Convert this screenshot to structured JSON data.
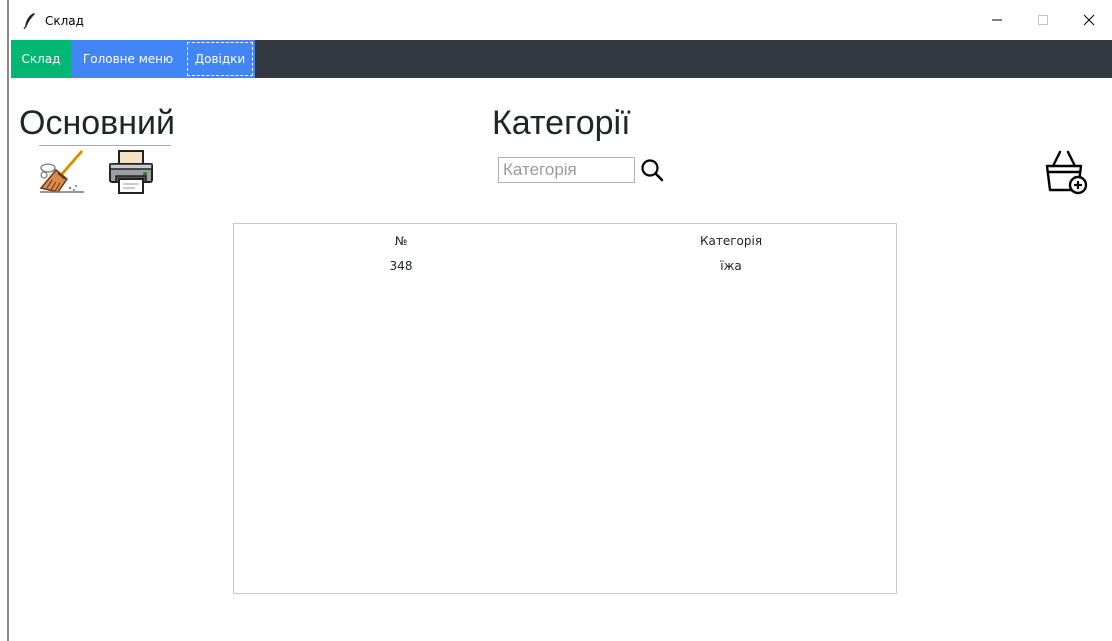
{
  "window": {
    "title": "Склад",
    "icon": "feather-icon",
    "controls": [
      "minimize-icon",
      "maximize-icon",
      "close-icon"
    ]
  },
  "menu": {
    "items": [
      {
        "label": "Склад",
        "color": "#00b774"
      },
      {
        "label": "Головне меню",
        "color": "#4285f4"
      },
      {
        "label": "Довідки",
        "color": "#4285f4"
      }
    ],
    "bar_color": "#343a40"
  },
  "main": {
    "left_title": "Основний",
    "center_title": "Категорії",
    "tools": [
      "broom-icon",
      "printer-icon"
    ],
    "add_icon": "basket-add-icon"
  },
  "search": {
    "placeholder": "Категорія",
    "value": "",
    "icon": "search-icon"
  },
  "table": {
    "columns": [
      "№",
      "Категорія"
    ],
    "rows": [
      [
        "348",
        "їжа"
      ]
    ]
  }
}
